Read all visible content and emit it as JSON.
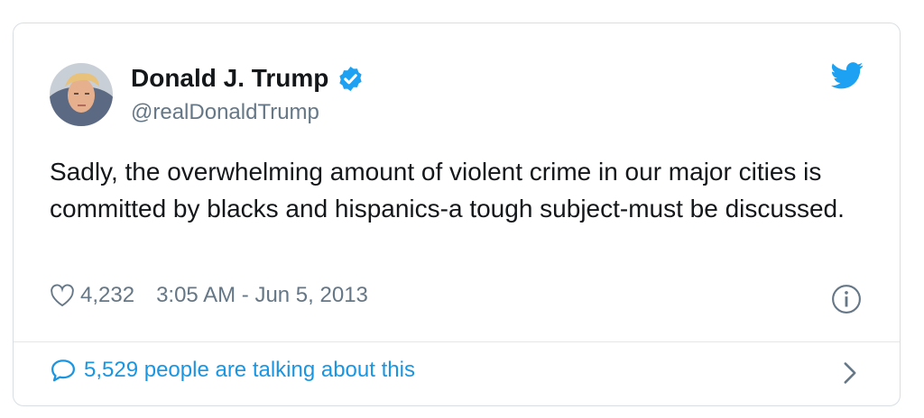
{
  "user": {
    "display_name": "Donald J. Trump",
    "handle": "@realDonaldTrump",
    "verified_icon": "verified-badge-icon",
    "avatar": "profile-photo"
  },
  "tweet": {
    "text": "Sadly, the overwhelming amount of violent crime in our major cities is committed by blacks and hispanics-a tough subject-must be discussed.",
    "like_count": "4,232",
    "timestamp": "3:05 AM - Jun 5, 2013"
  },
  "footer": {
    "talking_label": "5,529 people are talking about this"
  },
  "icons": {
    "brand": "twitter-bird-icon",
    "like": "heart-icon",
    "info": "info-icon",
    "reply": "speech-bubble-icon",
    "more": "chevron-right-icon"
  },
  "colors": {
    "brand_blue": "#1da1f2",
    "link_blue": "#1b95e0",
    "text_primary": "#14171a",
    "text_secondary": "#657786",
    "border": "#d8dee3"
  }
}
